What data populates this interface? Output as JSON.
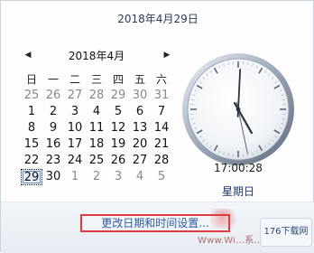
{
  "full_date": "2018年4月29日",
  "calendar": {
    "prev_icon": "triangle-left-icon",
    "next_icon": "triangle-right-icon",
    "month_title": "2018年4月",
    "weekdays": [
      "日",
      "一",
      "二",
      "三",
      "四",
      "五",
      "六"
    ],
    "weeks": [
      [
        "25",
        "26",
        "27",
        "28",
        "29",
        "30",
        "31"
      ],
      [
        "1",
        "2",
        "3",
        "4",
        "5",
        "6",
        "7"
      ],
      [
        "8",
        "9",
        "10",
        "11",
        "12",
        "13",
        "14"
      ],
      [
        "15",
        "16",
        "17",
        "18",
        "19",
        "20",
        "21"
      ],
      [
        "22",
        "23",
        "24",
        "25",
        "26",
        "27",
        "28"
      ],
      [
        "29",
        "30",
        "1",
        "2",
        "3",
        "4",
        "5"
      ]
    ],
    "gray_cells": [
      [
        0,
        0
      ],
      [
        0,
        1
      ],
      [
        0,
        2
      ],
      [
        0,
        3
      ],
      [
        0,
        4
      ],
      [
        0,
        5
      ],
      [
        0,
        6
      ],
      [
        5,
        2
      ],
      [
        5,
        3
      ],
      [
        5,
        4
      ],
      [
        5,
        5
      ],
      [
        5,
        6
      ]
    ],
    "today_cell": [
      5,
      0
    ]
  },
  "clock": {
    "icon": "analog-clock-icon",
    "hours": 17,
    "minutes": 0,
    "seconds": 28,
    "digital": "17:00:28",
    "weekday": "星期日"
  },
  "bottom": {
    "change_link": "更改日期和时间设置..."
  },
  "watermark": {
    "text": "Www.Wi...系...",
    "badge": "176下载网"
  }
}
